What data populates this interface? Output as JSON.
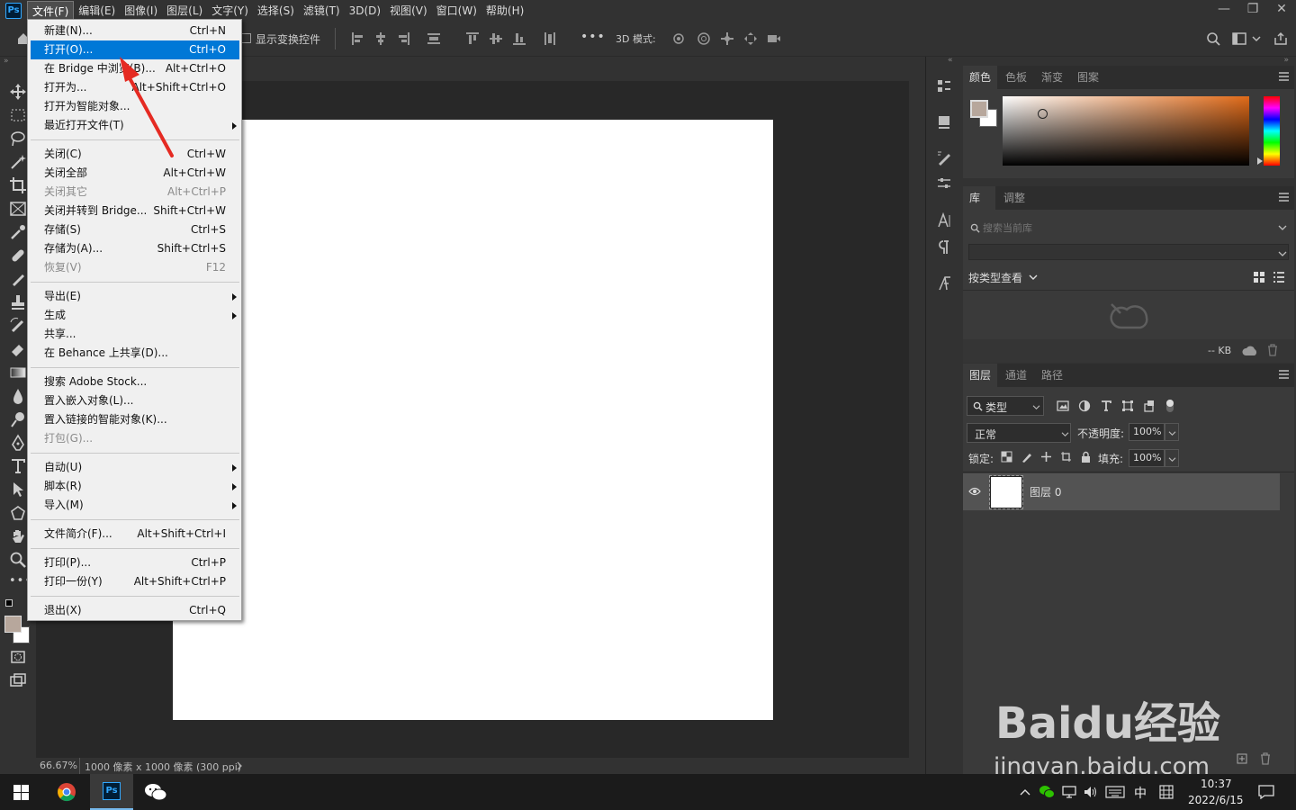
{
  "app": {
    "logo": "Ps",
    "menus": [
      "文件(F)",
      "编辑(E)",
      "图像(I)",
      "图层(L)",
      "文字(Y)",
      "选择(S)",
      "滤镜(T)",
      "3D(D)",
      "视图(V)",
      "窗口(W)",
      "帮助(H)"
    ],
    "window_controls": [
      "—",
      "❐",
      "✕"
    ]
  },
  "options": {
    "show_transform": "显示变换控件",
    "mode_3d": "3D 模式:",
    "more": "•••"
  },
  "file_menu": [
    {
      "label": "新建(N)...",
      "shortcut": "Ctrl+N"
    },
    {
      "label": "打开(O)...",
      "shortcut": "Ctrl+O",
      "highlight": true
    },
    {
      "label": "在 Bridge 中浏览(B)...",
      "shortcut": "Alt+Ctrl+O"
    },
    {
      "label": "打开为...",
      "shortcut": "Alt+Shift+Ctrl+O"
    },
    {
      "label": "打开为智能对象...",
      "shortcut": ""
    },
    {
      "label": "最近打开文件(T)",
      "shortcut": "",
      "submenu": true
    },
    {
      "label": "关闭(C)",
      "shortcut": "Ctrl+W"
    },
    {
      "label": "关闭全部",
      "shortcut": "Alt+Ctrl+W"
    },
    {
      "label": "关闭其它",
      "shortcut": "Alt+Ctrl+P",
      "disabled": true
    },
    {
      "label": "关闭并转到 Bridge...",
      "shortcut": "Shift+Ctrl+W"
    },
    {
      "label": "存储(S)",
      "shortcut": "Ctrl+S"
    },
    {
      "label": "存储为(A)...",
      "shortcut": "Shift+Ctrl+S"
    },
    {
      "label": "恢复(V)",
      "shortcut": "F12",
      "disabled": true
    },
    {
      "label": "导出(E)",
      "shortcut": "",
      "submenu": true
    },
    {
      "label": "生成",
      "shortcut": "",
      "submenu": true
    },
    {
      "label": "共享...",
      "shortcut": ""
    },
    {
      "label": "在 Behance 上共享(D)...",
      "shortcut": ""
    },
    {
      "label": "搜索 Adobe Stock...",
      "shortcut": ""
    },
    {
      "label": "置入嵌入对象(L)...",
      "shortcut": ""
    },
    {
      "label": "置入链接的智能对象(K)...",
      "shortcut": ""
    },
    {
      "label": "打包(G)...",
      "shortcut": "",
      "disabled": true
    },
    {
      "label": "自动(U)",
      "shortcut": "",
      "submenu": true
    },
    {
      "label": "脚本(R)",
      "shortcut": "",
      "submenu": true
    },
    {
      "label": "导入(M)",
      "shortcut": "",
      "submenu": true
    },
    {
      "label": "文件简介(F)...",
      "shortcut": "Alt+Shift+Ctrl+I"
    },
    {
      "label": "打印(P)...",
      "shortcut": "Ctrl+P"
    },
    {
      "label": "打印一份(Y)",
      "shortcut": "Alt+Shift+Ctrl+P"
    },
    {
      "label": "退出(X)",
      "shortcut": "Ctrl+Q"
    }
  ],
  "panels": {
    "color": {
      "tabs": [
        "颜色",
        "色板",
        "渐变",
        "图案"
      ],
      "fg_color": "#b7a79c",
      "bg_color": "#ffffff",
      "hue_color": "#e06a18"
    },
    "library": {
      "tabs": [
        "库",
        "调整"
      ],
      "search_placeholder": "搜索当前库",
      "view_label": "按类型查看",
      "size": "-- KB"
    },
    "layers": {
      "tabs": [
        "图层",
        "通道",
        "路径"
      ],
      "filter": "类型",
      "blend_mode": "正常",
      "opacity_label": "不透明度:",
      "opacity": "100%",
      "lock_label": "锁定:",
      "fill_label": "填充:",
      "fill": "100%",
      "layer_name": "图层 0"
    }
  },
  "status": {
    "zoom": "66.67%",
    "doc_info": "1000 像素 x 1000 像素 (300 ppi)"
  },
  "taskbar": {
    "time": "10:37",
    "date": "2022/6/15",
    "ime": "中"
  },
  "watermark": {
    "brand": "Baidu经验",
    "url": "jingyan.baidu.com"
  }
}
